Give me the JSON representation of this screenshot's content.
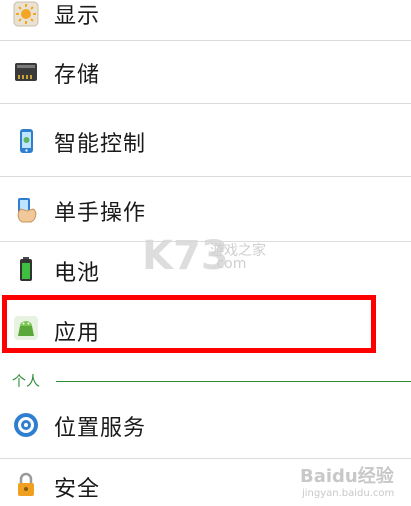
{
  "settings": {
    "items": [
      {
        "label": "显示",
        "icon": "display-sun-icon"
      },
      {
        "label": "存储",
        "icon": "storage-card-icon"
      },
      {
        "label": "智能控制",
        "icon": "smart-control-phone-icon"
      },
      {
        "label": "单手操作",
        "icon": "one-hand-operation-icon"
      },
      {
        "label": "电池",
        "icon": "battery-icon"
      },
      {
        "label": "应用",
        "icon": "android-apps-icon"
      }
    ],
    "section_personal": "个人",
    "personal_items": [
      {
        "label": "位置服务",
        "icon": "location-service-icon"
      },
      {
        "label": "安全",
        "icon": "lock-security-icon"
      }
    ]
  },
  "watermarks": {
    "k73_logo": "K73",
    "k73_site_name": "游戏之家",
    "k73_domain": ".com",
    "baidu_logo": "Baidu经验",
    "baidu_url": "jingyan.baidu.com"
  },
  "colors": {
    "highlight": "#ff0000",
    "section_accent": "#2e8b36",
    "divider": "#dcdcdc"
  }
}
